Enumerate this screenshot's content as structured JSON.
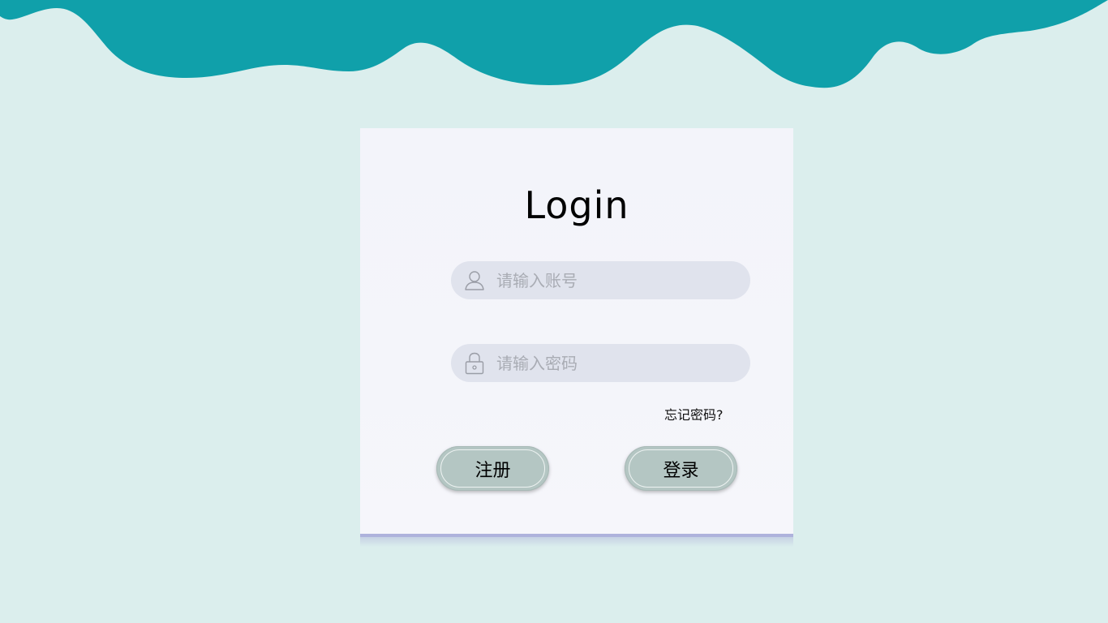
{
  "title": "Login",
  "account_field": {
    "placeholder": "请输入账号",
    "icon": "user-icon"
  },
  "password_field": {
    "placeholder": "请输入密码",
    "icon": "lock-icon"
  },
  "forgot_password_label": "忘记密码?",
  "register_label": "注册",
  "login_label": "登录",
  "colors": {
    "background": "#dbeeed",
    "wave": "#10a0aa",
    "card": "#f4f5fa",
    "input_bg": "#e0e3ed",
    "button_bg": "#b4c6c3",
    "card_bottom_line": "#aeb2dc"
  }
}
